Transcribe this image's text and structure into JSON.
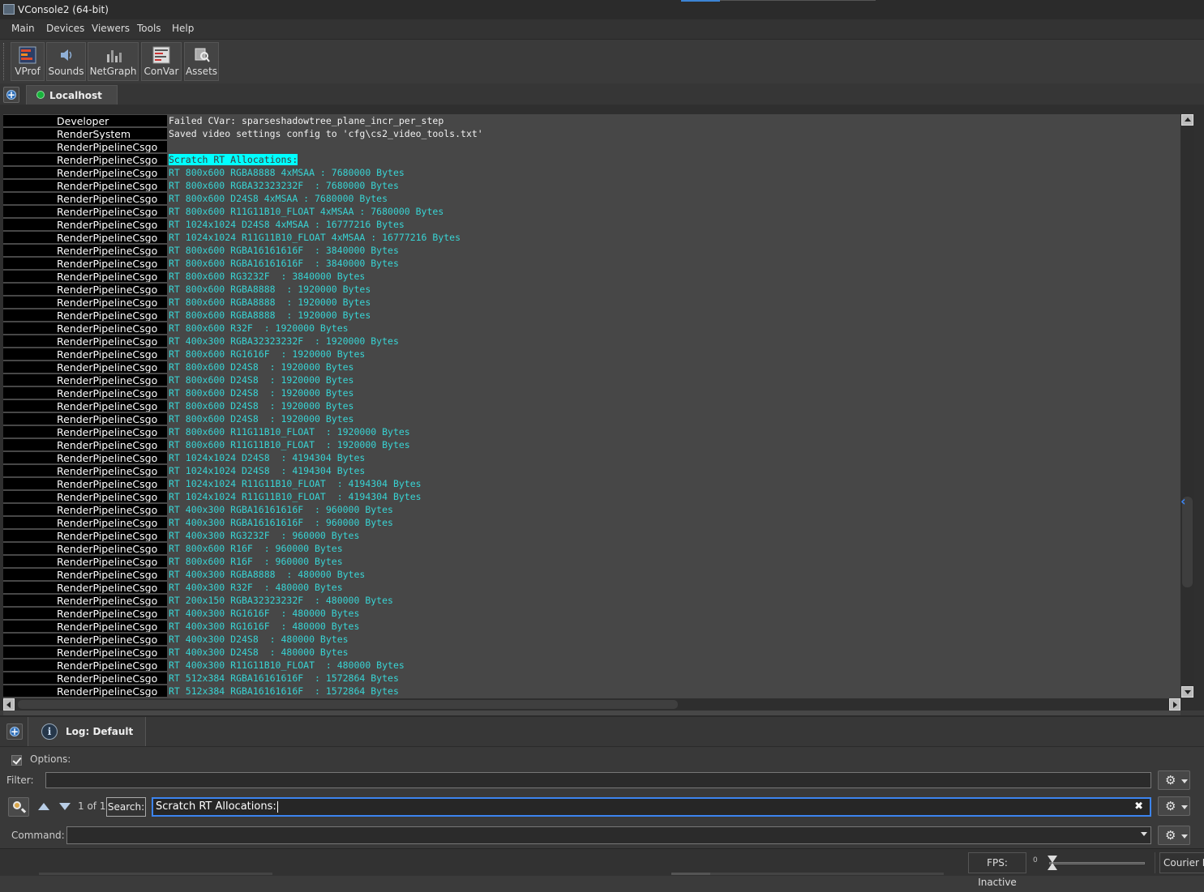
{
  "window": {
    "title": "VConsole2 (64-bit)"
  },
  "menu": [
    "Main",
    "Devices",
    "Viewers",
    "Tools",
    "Help"
  ],
  "toolbar": [
    {
      "label": "VProf",
      "icon": "vprof-icon"
    },
    {
      "label": "Sounds",
      "icon": "speaker-icon"
    },
    {
      "label": "NetGraph",
      "icon": "netgraph-icon"
    },
    {
      "label": "ConVar",
      "icon": "convar-icon"
    },
    {
      "label": "Assets",
      "icon": "assets-icon"
    }
  ],
  "connection_tab": {
    "label": "Localhost",
    "status_color": "#17b33b"
  },
  "log": {
    "colors": {
      "white": "#f0f0f0",
      "cyan": "#38d4d4",
      "highlight": "#00ffff"
    },
    "rows": [
      {
        "cat": "Developer",
        "msg": "Failed CVar: sparseshadowtree_plane_incr_per_step",
        "style": "white"
      },
      {
        "cat": "RenderSystem",
        "msg": "Saved video settings config to 'cfg\\cs2_video_tools.txt'",
        "style": "white"
      },
      {
        "cat": "RenderPipelineCsgo",
        "msg": "",
        "style": "white"
      },
      {
        "cat": "RenderPipelineCsgo",
        "msg": "Scratch RT Allocations:",
        "style": "hl"
      },
      {
        "cat": "RenderPipelineCsgo",
        "msg": "RT 800x600 RGBA8888 4xMSAA : 7680000 Bytes",
        "style": "cyan"
      },
      {
        "cat": "RenderPipelineCsgo",
        "msg": "RT 800x600 RGBA32323232F  : 7680000 Bytes",
        "style": "cyan"
      },
      {
        "cat": "RenderPipelineCsgo",
        "msg": "RT 800x600 D24S8 4xMSAA : 7680000 Bytes",
        "style": "cyan"
      },
      {
        "cat": "RenderPipelineCsgo",
        "msg": "RT 800x600 R11G11B10_FLOAT 4xMSAA : 7680000 Bytes",
        "style": "cyan"
      },
      {
        "cat": "RenderPipelineCsgo",
        "msg": "RT 1024x1024 D24S8 4xMSAA : 16777216 Bytes",
        "style": "cyan"
      },
      {
        "cat": "RenderPipelineCsgo",
        "msg": "RT 1024x1024 R11G11B10_FLOAT 4xMSAA : 16777216 Bytes",
        "style": "cyan"
      },
      {
        "cat": "RenderPipelineCsgo",
        "msg": "RT 800x600 RGBA16161616F  : 3840000 Bytes",
        "style": "cyan"
      },
      {
        "cat": "RenderPipelineCsgo",
        "msg": "RT 800x600 RGBA16161616F  : 3840000 Bytes",
        "style": "cyan"
      },
      {
        "cat": "RenderPipelineCsgo",
        "msg": "RT 800x600 RG3232F  : 3840000 Bytes",
        "style": "cyan"
      },
      {
        "cat": "RenderPipelineCsgo",
        "msg": "RT 800x600 RGBA8888  : 1920000 Bytes",
        "style": "cyan"
      },
      {
        "cat": "RenderPipelineCsgo",
        "msg": "RT 800x600 RGBA8888  : 1920000 Bytes",
        "style": "cyan"
      },
      {
        "cat": "RenderPipelineCsgo",
        "msg": "RT 800x600 RGBA8888  : 1920000 Bytes",
        "style": "cyan"
      },
      {
        "cat": "RenderPipelineCsgo",
        "msg": "RT 800x600 R32F  : 1920000 Bytes",
        "style": "cyan"
      },
      {
        "cat": "RenderPipelineCsgo",
        "msg": "RT 400x300 RGBA32323232F  : 1920000 Bytes",
        "style": "cyan"
      },
      {
        "cat": "RenderPipelineCsgo",
        "msg": "RT 800x600 RG1616F  : 1920000 Bytes",
        "style": "cyan"
      },
      {
        "cat": "RenderPipelineCsgo",
        "msg": "RT 800x600 D24S8  : 1920000 Bytes",
        "style": "cyan"
      },
      {
        "cat": "RenderPipelineCsgo",
        "msg": "RT 800x600 D24S8  : 1920000 Bytes",
        "style": "cyan"
      },
      {
        "cat": "RenderPipelineCsgo",
        "msg": "RT 800x600 D24S8  : 1920000 Bytes",
        "style": "cyan"
      },
      {
        "cat": "RenderPipelineCsgo",
        "msg": "RT 800x600 D24S8  : 1920000 Bytes",
        "style": "cyan"
      },
      {
        "cat": "RenderPipelineCsgo",
        "msg": "RT 800x600 D24S8  : 1920000 Bytes",
        "style": "cyan"
      },
      {
        "cat": "RenderPipelineCsgo",
        "msg": "RT 800x600 R11G11B10_FLOAT  : 1920000 Bytes",
        "style": "cyan"
      },
      {
        "cat": "RenderPipelineCsgo",
        "msg": "RT 800x600 R11G11B10_FLOAT  : 1920000 Bytes",
        "style": "cyan"
      },
      {
        "cat": "RenderPipelineCsgo",
        "msg": "RT 1024x1024 D24S8  : 4194304 Bytes",
        "style": "cyan"
      },
      {
        "cat": "RenderPipelineCsgo",
        "msg": "RT 1024x1024 D24S8  : 4194304 Bytes",
        "style": "cyan"
      },
      {
        "cat": "RenderPipelineCsgo",
        "msg": "RT 1024x1024 R11G11B10_FLOAT  : 4194304 Bytes",
        "style": "cyan"
      },
      {
        "cat": "RenderPipelineCsgo",
        "msg": "RT 1024x1024 R11G11B10_FLOAT  : 4194304 Bytes",
        "style": "cyan"
      },
      {
        "cat": "RenderPipelineCsgo",
        "msg": "RT 400x300 RGBA16161616F  : 960000 Bytes",
        "style": "cyan"
      },
      {
        "cat": "RenderPipelineCsgo",
        "msg": "RT 400x300 RGBA16161616F  : 960000 Bytes",
        "style": "cyan"
      },
      {
        "cat": "RenderPipelineCsgo",
        "msg": "RT 400x300 RG3232F  : 960000 Bytes",
        "style": "cyan"
      },
      {
        "cat": "RenderPipelineCsgo",
        "msg": "RT 800x600 R16F  : 960000 Bytes",
        "style": "cyan"
      },
      {
        "cat": "RenderPipelineCsgo",
        "msg": "RT 800x600 R16F  : 960000 Bytes",
        "style": "cyan"
      },
      {
        "cat": "RenderPipelineCsgo",
        "msg": "RT 400x300 RGBA8888  : 480000 Bytes",
        "style": "cyan"
      },
      {
        "cat": "RenderPipelineCsgo",
        "msg": "RT 400x300 R32F  : 480000 Bytes",
        "style": "cyan"
      },
      {
        "cat": "RenderPipelineCsgo",
        "msg": "RT 200x150 RGBA32323232F  : 480000 Bytes",
        "style": "cyan"
      },
      {
        "cat": "RenderPipelineCsgo",
        "msg": "RT 400x300 RG1616F  : 480000 Bytes",
        "style": "cyan"
      },
      {
        "cat": "RenderPipelineCsgo",
        "msg": "RT 400x300 RG1616F  : 480000 Bytes",
        "style": "cyan"
      },
      {
        "cat": "RenderPipelineCsgo",
        "msg": "RT 400x300 D24S8  : 480000 Bytes",
        "style": "cyan"
      },
      {
        "cat": "RenderPipelineCsgo",
        "msg": "RT 400x300 D24S8  : 480000 Bytes",
        "style": "cyan"
      },
      {
        "cat": "RenderPipelineCsgo",
        "msg": "RT 400x300 R11G11B10_FLOAT  : 480000 Bytes",
        "style": "cyan"
      },
      {
        "cat": "RenderPipelineCsgo",
        "msg": "RT 512x384 RGBA16161616F  : 1572864 Bytes",
        "style": "cyan"
      },
      {
        "cat": "RenderPipelineCsgo",
        "msg": "RT 512x384 RGBA16161616F  : 1572864 Bytes",
        "style": "cyan"
      }
    ]
  },
  "log_tab": {
    "label": "Log: Default"
  },
  "options": {
    "label": "Options:",
    "checked": true
  },
  "filter": {
    "label": "Filter:",
    "value": ""
  },
  "search": {
    "match_count": "1 of 1",
    "button_label": "Search:",
    "value": "Scratch RT Allocations:",
    "clear_glyph": "✖"
  },
  "command": {
    "label": "Command:",
    "value": ""
  },
  "status": {
    "fps": "FPS: Inactive",
    "slider_min": "0",
    "font": "Courier N"
  }
}
